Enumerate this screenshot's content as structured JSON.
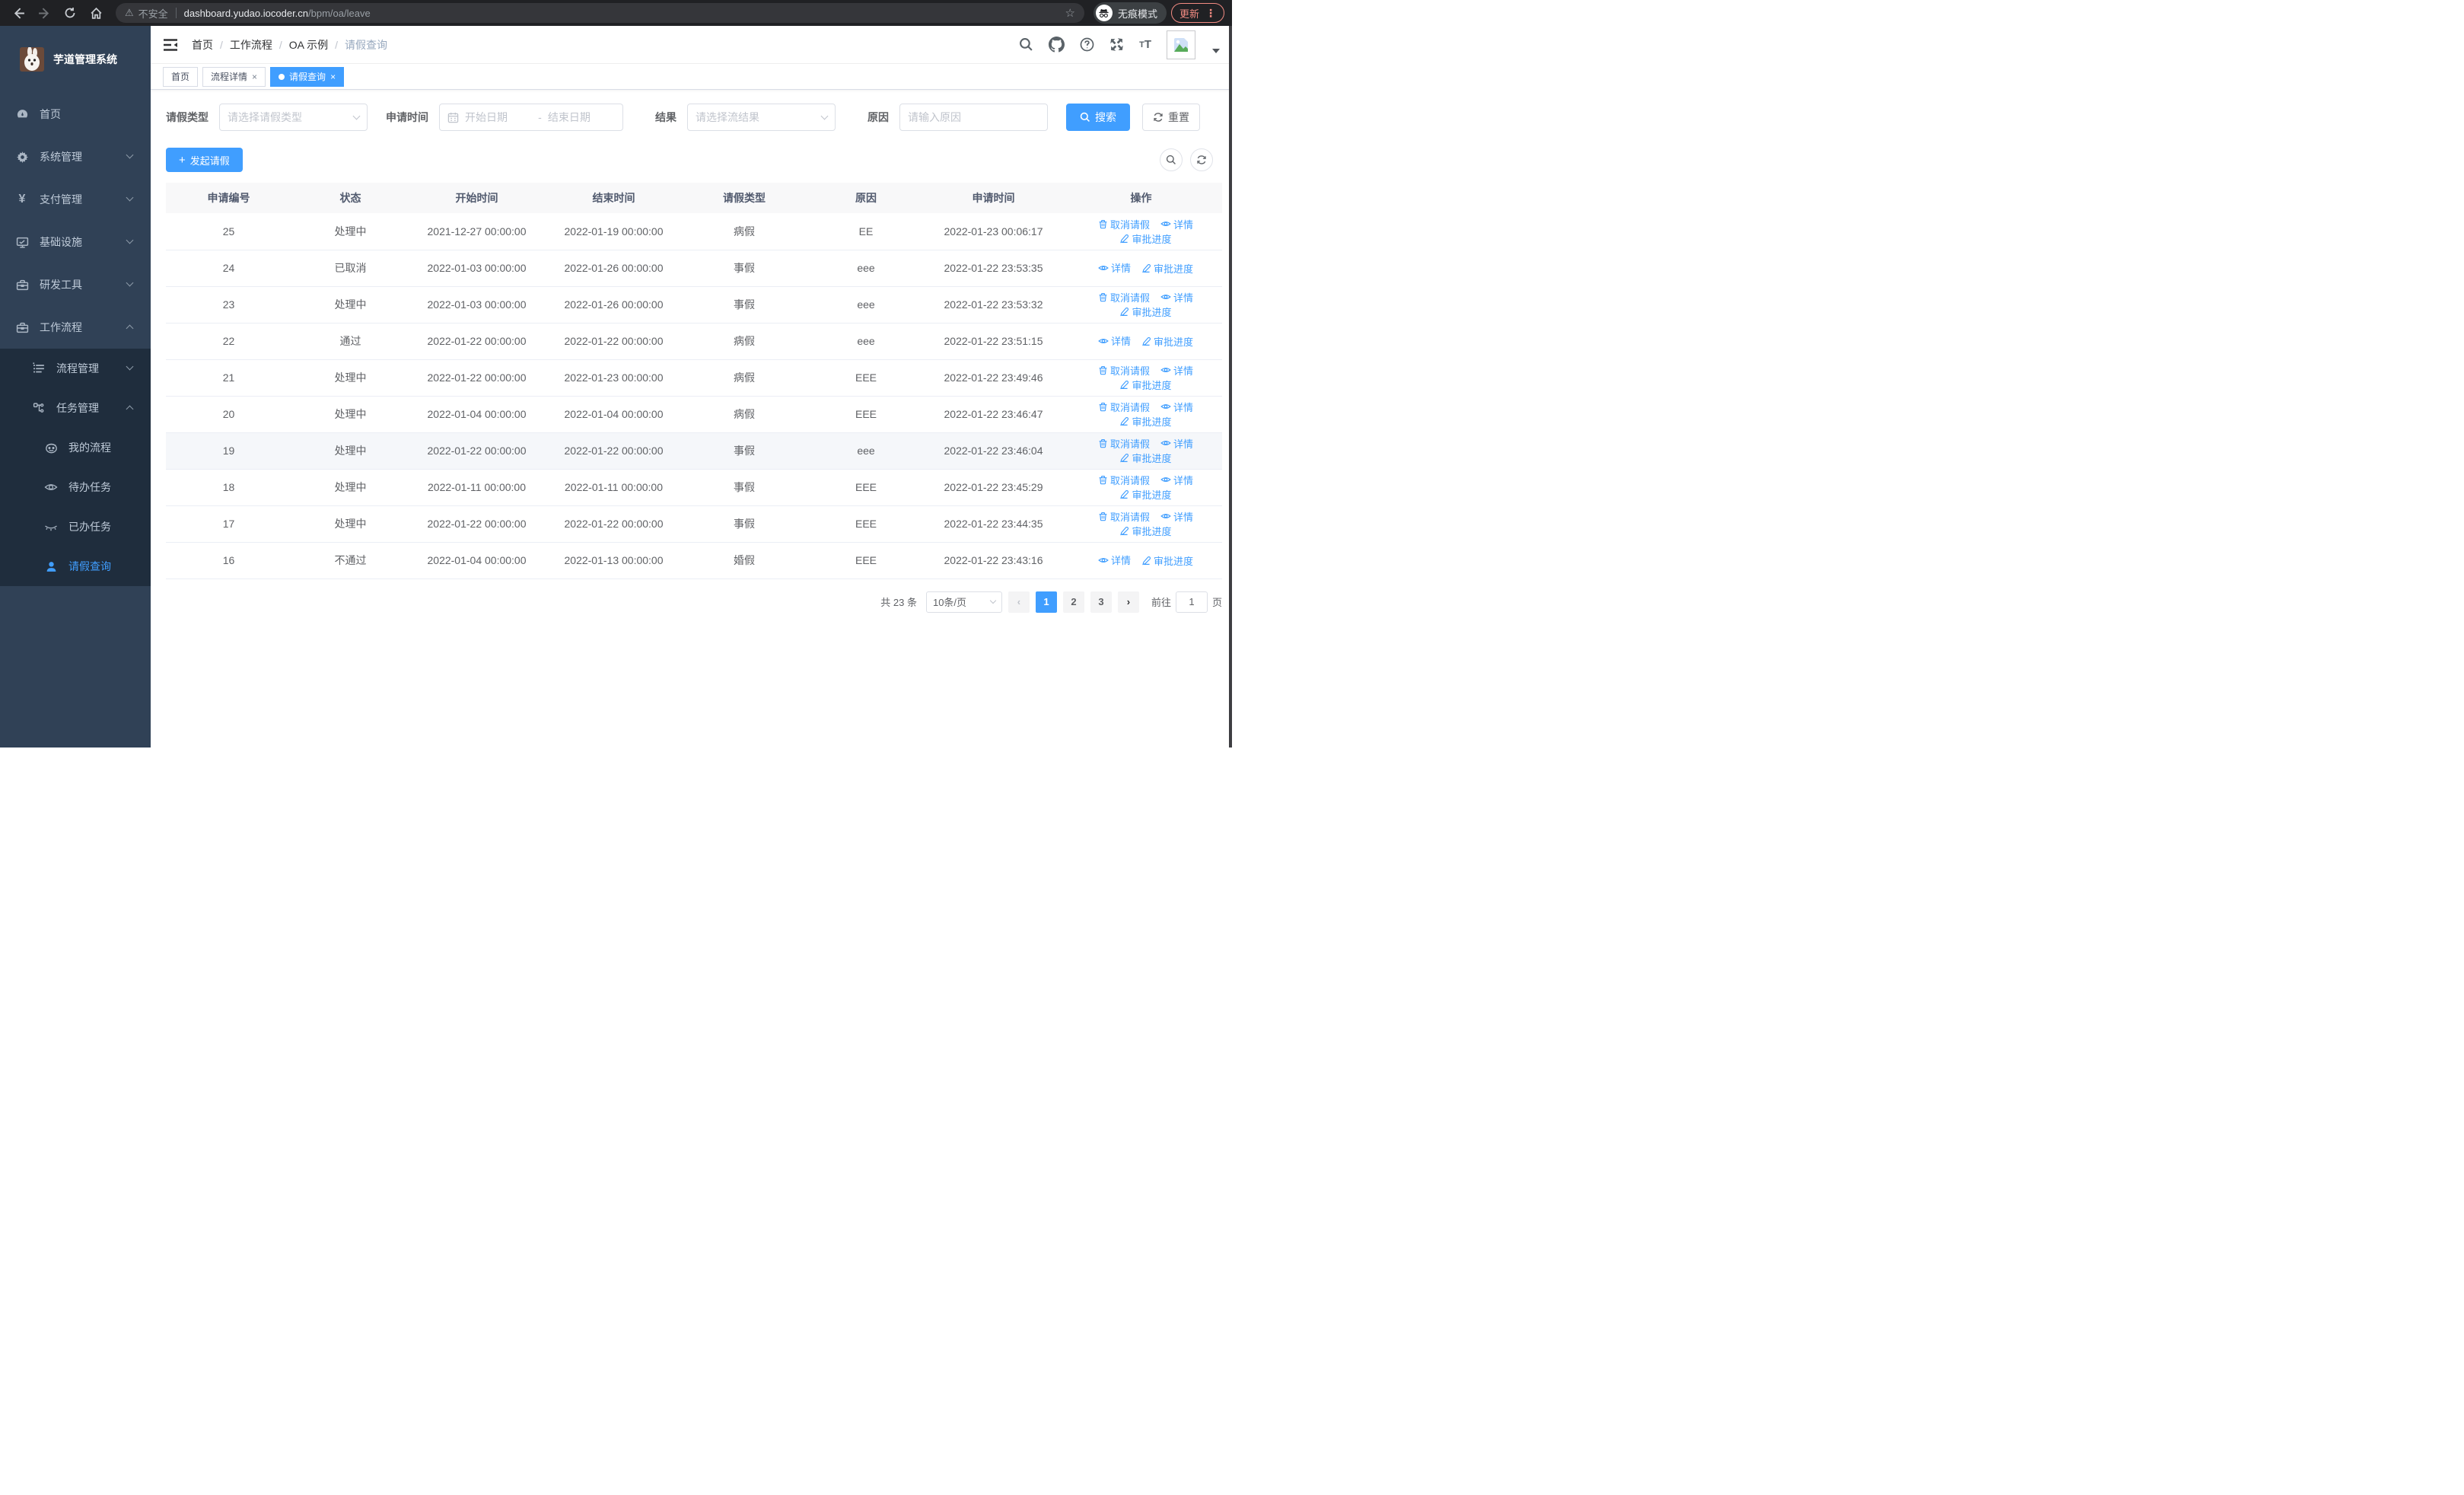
{
  "browser": {
    "security_label": "不安全",
    "url_host": "dashboard.yudao.iocoder.cn",
    "url_path": "/bpm/oa/leave",
    "incognito_label": "无痕模式",
    "update_label": "更新",
    "menu_dots": "⋮"
  },
  "sidebar": {
    "app_title": "芋道管理系统",
    "items": [
      {
        "name": "home",
        "label": "首页",
        "icon": "gauge-icon",
        "level": 1
      },
      {
        "name": "system-management",
        "label": "系统管理",
        "icon": "gear-icon",
        "level": 1,
        "chevron": "down"
      },
      {
        "name": "payment-management",
        "label": "支付管理",
        "icon": "yen-icon",
        "level": 1,
        "chevron": "down"
      },
      {
        "name": "infrastructure",
        "label": "基础设施",
        "icon": "monitor-icon",
        "level": 1,
        "chevron": "down"
      },
      {
        "name": "dev-tools",
        "label": "研发工具",
        "icon": "toolbox-icon",
        "level": 1,
        "chevron": "down"
      },
      {
        "name": "workflow",
        "label": "工作流程",
        "icon": "toolbox-icon",
        "level": 1,
        "chevron": "up"
      },
      {
        "name": "process-management",
        "label": "流程管理",
        "icon": "list-icon",
        "level": 2,
        "chevron": "down",
        "dark": true
      },
      {
        "name": "task-management",
        "label": "任务管理",
        "icon": "branch-icon",
        "level": 2,
        "chevron": "up",
        "dark": true
      },
      {
        "name": "my-processes",
        "label": "我的流程",
        "icon": "robot-icon",
        "level": 3,
        "dark": true
      },
      {
        "name": "todo-tasks",
        "label": "待办任务",
        "icon": "eye-open-icon",
        "level": 3,
        "dark": true
      },
      {
        "name": "done-tasks",
        "label": "已办任务",
        "icon": "eye-closed-icon",
        "level": 3,
        "dark": true
      },
      {
        "name": "leave-query",
        "label": "请假查询",
        "icon": "person-icon",
        "level": 3,
        "dark": true,
        "active": true
      }
    ]
  },
  "header": {
    "breadcrumbs": [
      "首页",
      "工作流程",
      "OA 示例",
      "请假查询"
    ]
  },
  "tabs": [
    {
      "label": "首页",
      "closable": false,
      "active": false
    },
    {
      "label": "流程详情",
      "closable": true,
      "active": false
    },
    {
      "label": "请假查询",
      "closable": true,
      "active": true
    }
  ],
  "filters": {
    "leave_type_label": "请假类型",
    "leave_type_placeholder": "请选择请假类型",
    "apply_time_label": "申请时间",
    "start_date_placeholder": "开始日期",
    "range_separator": "-",
    "end_date_placeholder": "结束日期",
    "result_label": "结果",
    "result_placeholder": "请选择流结果",
    "reason_label": "原因",
    "reason_placeholder": "请输入原因",
    "search_label": "搜索",
    "reset_label": "重置"
  },
  "toolbar": {
    "create_label": "发起请假"
  },
  "table": {
    "columns": [
      "申请编号",
      "状态",
      "开始时间",
      "结束时间",
      "请假类型",
      "原因",
      "申请时间",
      "操作"
    ],
    "action_labels": {
      "cancel": "取消请假",
      "detail": "详情",
      "progress": "审批进度"
    },
    "rows": [
      {
        "id": "25",
        "status": "处理中",
        "start": "2021-12-27 00:00:00",
        "end": "2022-01-19 00:00:00",
        "type": "病假",
        "reason": "EE",
        "apply_time": "2022-01-23 00:06:17",
        "actions": [
          "cancel",
          "detail",
          "progress"
        ],
        "hover": false
      },
      {
        "id": "24",
        "status": "已取消",
        "start": "2022-01-03 00:00:00",
        "end": "2022-01-26 00:00:00",
        "type": "事假",
        "reason": "eee",
        "apply_time": "2022-01-22 23:53:35",
        "actions": [
          "detail",
          "progress"
        ],
        "hover": false
      },
      {
        "id": "23",
        "status": "处理中",
        "start": "2022-01-03 00:00:00",
        "end": "2022-01-26 00:00:00",
        "type": "事假",
        "reason": "eee",
        "apply_time": "2022-01-22 23:53:32",
        "actions": [
          "cancel",
          "detail",
          "progress"
        ],
        "hover": false
      },
      {
        "id": "22",
        "status": "通过",
        "start": "2022-01-22 00:00:00",
        "end": "2022-01-22 00:00:00",
        "type": "病假",
        "reason": "eee",
        "apply_time": "2022-01-22 23:51:15",
        "actions": [
          "detail",
          "progress"
        ],
        "hover": false
      },
      {
        "id": "21",
        "status": "处理中",
        "start": "2022-01-22 00:00:00",
        "end": "2022-01-23 00:00:00",
        "type": "病假",
        "reason": "EEE",
        "apply_time": "2022-01-22 23:49:46",
        "actions": [
          "cancel",
          "detail",
          "progress"
        ],
        "hover": false
      },
      {
        "id": "20",
        "status": "处理中",
        "start": "2022-01-04 00:00:00",
        "end": "2022-01-04 00:00:00",
        "type": "病假",
        "reason": "EEE",
        "apply_time": "2022-01-22 23:46:47",
        "actions": [
          "cancel",
          "detail",
          "progress"
        ],
        "hover": false
      },
      {
        "id": "19",
        "status": "处理中",
        "start": "2022-01-22 00:00:00",
        "end": "2022-01-22 00:00:00",
        "type": "事假",
        "reason": "eee",
        "apply_time": "2022-01-22 23:46:04",
        "actions": [
          "cancel",
          "detail",
          "progress"
        ],
        "hover": true
      },
      {
        "id": "18",
        "status": "处理中",
        "start": "2022-01-11 00:00:00",
        "end": "2022-01-11 00:00:00",
        "type": "事假",
        "reason": "EEE",
        "apply_time": "2022-01-22 23:45:29",
        "actions": [
          "cancel",
          "detail",
          "progress"
        ],
        "hover": false
      },
      {
        "id": "17",
        "status": "处理中",
        "start": "2022-01-22 00:00:00",
        "end": "2022-01-22 00:00:00",
        "type": "事假",
        "reason": "EEE",
        "apply_time": "2022-01-22 23:44:35",
        "actions": [
          "cancel",
          "detail",
          "progress"
        ],
        "hover": false
      },
      {
        "id": "16",
        "status": "不通过",
        "start": "2022-01-04 00:00:00",
        "end": "2022-01-13 00:00:00",
        "type": "婚假",
        "reason": "EEE",
        "apply_time": "2022-01-22 23:43:16",
        "actions": [
          "detail",
          "progress"
        ],
        "hover": false
      }
    ]
  },
  "pagination": {
    "total_label": "共 23 条",
    "page_size": "10条/页",
    "prev": "‹",
    "pages": [
      "1",
      "2",
      "3"
    ],
    "active_page": "1",
    "next": "›",
    "goto_label": "前往",
    "goto_value": "1",
    "page_unit": "页"
  },
  "colors": {
    "primary": "#409eff",
    "sidebar_bg": "#304156",
    "submenu_bg": "#1f2d3d",
    "update_accent": "#f28b82"
  }
}
